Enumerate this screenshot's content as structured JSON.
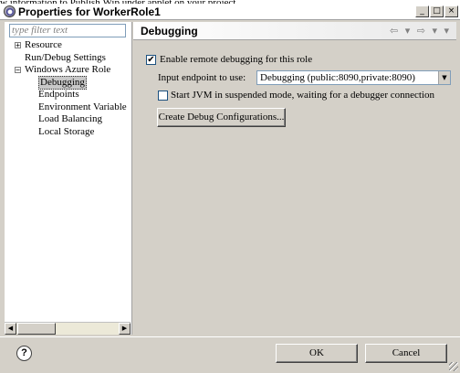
{
  "window": {
    "title": "Properties for WorkerRole1",
    "controls": {
      "minimize": "_",
      "maximize": "□",
      "close": "×"
    },
    "background_text": "w information to Publish.Wip under applet on your project"
  },
  "sidebar": {
    "filter_placeholder": "type filter text",
    "items": [
      {
        "label": "Resource",
        "level": 0,
        "expander": "+"
      },
      {
        "label": "Run/Debug Settings",
        "level": 0,
        "expander": ""
      },
      {
        "label": "Windows Azure Role",
        "level": 0,
        "expander": "−"
      },
      {
        "label": "Debugging",
        "level": 1,
        "selected": true
      },
      {
        "label": "Endpoints",
        "level": 1
      },
      {
        "label": "Environment Variable",
        "level": 1
      },
      {
        "label": "Load Balancing",
        "level": 1
      },
      {
        "label": "Local Storage",
        "level": 1
      }
    ]
  },
  "page": {
    "title": "Debugging",
    "nav_arrows": "⇦ ▾ ⇨ ▾ ▾",
    "enable_checkbox": {
      "label": "Enable remote debugging for this role",
      "checked": true
    },
    "endpoint": {
      "label": "Input endpoint to use:",
      "value": "Debugging (public:8090,private:8090)"
    },
    "suspend_checkbox": {
      "label": "Start JVM in suspended mode, waiting for a debugger connection",
      "checked": false
    },
    "create_button": "Create Debug Configurations..."
  },
  "footer": {
    "help_icon": "?",
    "ok_label": "OK",
    "cancel_label": "Cancel"
  },
  "icons": {
    "check": "✔",
    "dropdown": "▼",
    "scroll_left": "◀",
    "scroll_right": "▶"
  }
}
